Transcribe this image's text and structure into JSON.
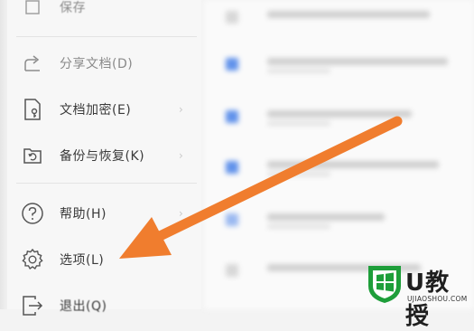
{
  "menu": {
    "items": [
      {
        "label": "保存",
        "icon": "save-icon"
      },
      {
        "label": "分享文档(D)",
        "icon": "share-icon"
      },
      {
        "label": "文档加密(E)",
        "icon": "encrypt-document-icon",
        "submenu": true
      },
      {
        "label": "备份与恢复(K)",
        "icon": "backup-restore-icon",
        "submenu": true
      },
      {
        "label": "帮助(H)",
        "icon": "help-icon",
        "submenu": true
      },
      {
        "label": "选项(L)",
        "icon": "gear-icon"
      },
      {
        "label": "退出(Q)",
        "icon": "exit-icon"
      }
    ],
    "submenu_arrow": "›"
  },
  "watermark": {
    "title": "U教授",
    "url": "UJIAOSHOU.COM"
  },
  "colors": {
    "arrow": "#f07d2e",
    "accent": "#3b78e7",
    "watermark_green": "#1e9e3a"
  }
}
